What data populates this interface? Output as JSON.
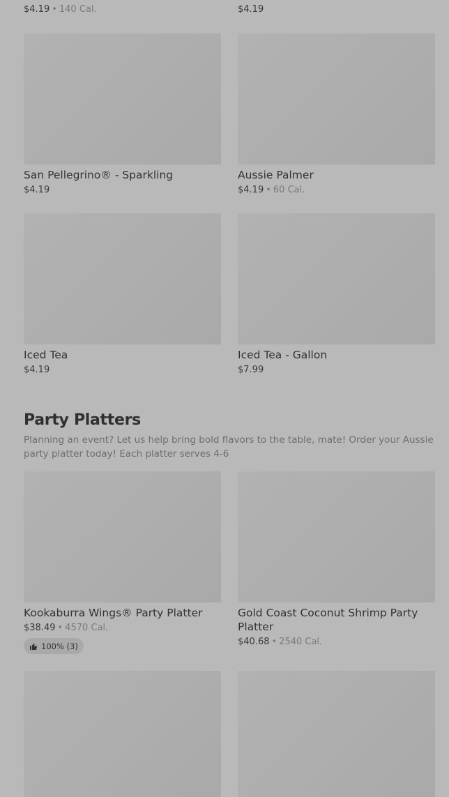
{
  "top_row": {
    "left": {
      "price": "$4.19",
      "calories": "140 Cal."
    },
    "right": {
      "price": "$4.19"
    }
  },
  "drinks": [
    {
      "name": "San Pellegrino® - Sparkling",
      "price": "$4.19"
    },
    {
      "name": "Aussie Palmer",
      "price": "$4.19",
      "calories": "60 Cal."
    },
    {
      "name": "Iced Tea",
      "price": "$4.19"
    },
    {
      "name": "Iced Tea - Gallon",
      "price": "$7.99"
    }
  ],
  "section": {
    "title": "Party Platters",
    "description": "Planning an event? Let us help bring bold flavors to the table, mate! Order your Aussie party platter today! Each platter serves 4-6"
  },
  "platters": [
    {
      "name": "Kookaburra Wings® Party Platter",
      "price": "$38.49",
      "calories": "4570 Cal.",
      "rating": "100% (3)"
    },
    {
      "name": "Gold Coast Coconut Shrimp Party Platter",
      "price": "$40.68",
      "calories": "2540 Cal."
    }
  ],
  "icons": {
    "rating": "thumbs-up-icon"
  },
  "colors": {
    "background": "#b9b9b9",
    "placeholder": "#aeaeae",
    "text": "#2b2b2b",
    "muted": "#7a7a7a"
  }
}
